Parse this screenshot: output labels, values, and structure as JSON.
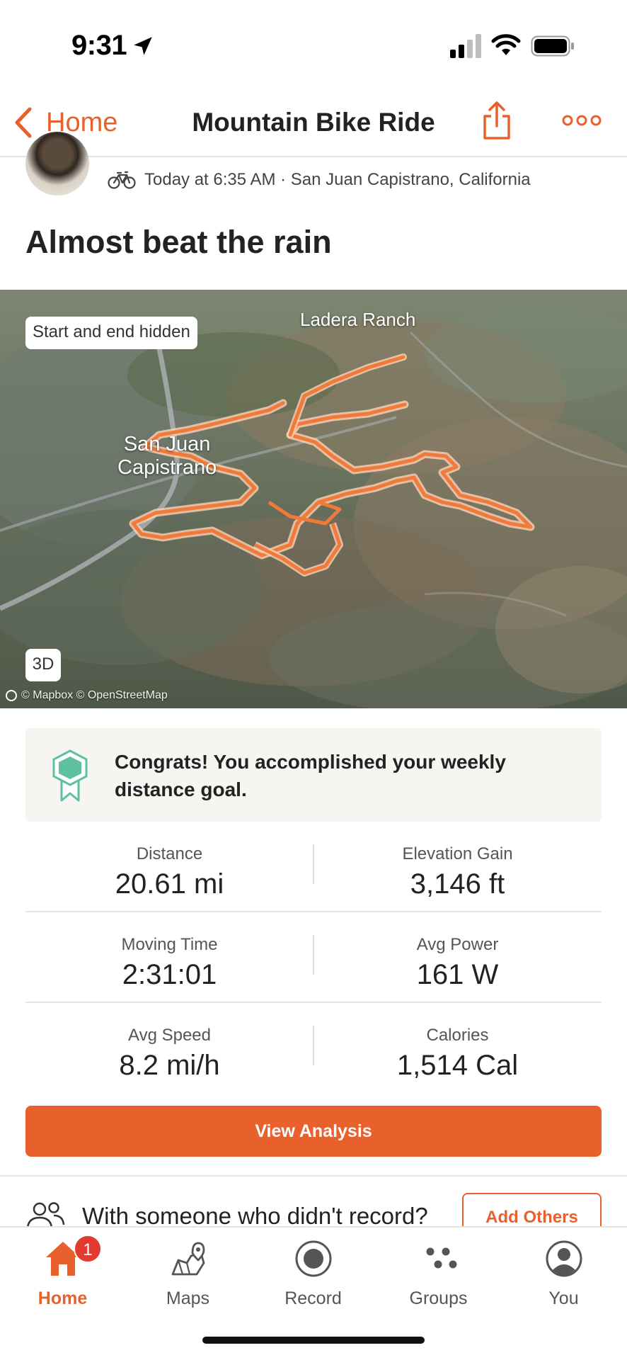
{
  "status_bar": {
    "time": "9:31"
  },
  "nav": {
    "back_label": "Home",
    "title": "Mountain Bike Ride"
  },
  "activity": {
    "meta": "Today at 6:35 AM · San Juan Capistrano, California",
    "title": "Almost beat the rain"
  },
  "map": {
    "privacy_chip": "Start and end hidden",
    "view_chip": "3D",
    "place_labels": [
      "Ladera Ranch",
      "San Juan\nCapistrano"
    ],
    "attribution": "© Mapbox © OpenStreetMap",
    "route_color": "#f07a3a"
  },
  "congrats": {
    "text": "Congrats! You accomplished your weekly distance goal."
  },
  "stats": [
    {
      "label": "Distance",
      "value": "20.61 mi"
    },
    {
      "label": "Elevation Gain",
      "value": "3,146 ft"
    },
    {
      "label": "Moving Time",
      "value": "2:31:01"
    },
    {
      "label": "Avg Power",
      "value": "161 W"
    },
    {
      "label": "Avg Speed",
      "value": "8.2 mi/h"
    },
    {
      "label": "Calories",
      "value": "1,514 Cal"
    }
  ],
  "actions": {
    "view_analysis": "View Analysis",
    "with_someone": "With someone who didn't record?",
    "add_others": "Add Others"
  },
  "tabs": [
    {
      "label": "Home",
      "icon": "home-icon",
      "badge": "1",
      "active": true
    },
    {
      "label": "Maps",
      "icon": "maps-icon"
    },
    {
      "label": "Record",
      "icon": "record-icon"
    },
    {
      "label": "Groups",
      "icon": "groups-icon"
    },
    {
      "label": "You",
      "icon": "profile-icon"
    }
  ],
  "colors": {
    "accent": "#e8612c",
    "badge": "#e33a2f",
    "goal_icon": "#5fc0a0"
  }
}
